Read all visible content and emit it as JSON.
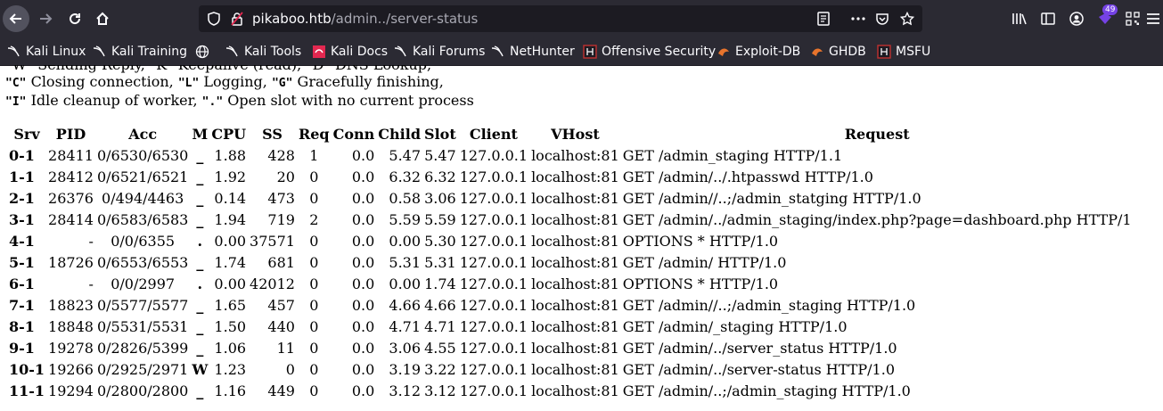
{
  "browser": {
    "url_host": "pikaboo.htb",
    "url_path": "/admin../server-status",
    "extensions_badge": "49"
  },
  "bookmarks": [
    {
      "label": "Kali Linux",
      "icon": "kali-dragon-icon"
    },
    {
      "label": "Kali Training",
      "icon": "kali-dragon-icon"
    },
    {
      "label": "",
      "icon": "globe-icon"
    },
    {
      "label": "Kali Tools",
      "icon": "kali-dragon-icon"
    },
    {
      "label": "Kali Docs",
      "icon": "kali-docs-icon"
    },
    {
      "label": "Kali Forums",
      "icon": "kali-dragon-icon"
    },
    {
      "label": "NetHunter",
      "icon": "kali-dragon-icon"
    },
    {
      "label": "Offensive Security",
      "icon": "offsec-icon"
    },
    {
      "label": "Exploit-DB",
      "icon": "exploitdb-icon"
    },
    {
      "label": "GHDB",
      "icon": "exploitdb-icon"
    },
    {
      "label": "MSFU",
      "icon": "offsec-icon"
    }
  ],
  "legend": {
    "line0": "\"W\" Sending Reply, \"K\" Keepalive (read), \"D\" DNS Lookup,",
    "line1_k1": "\"C\"",
    "line1_t1": " Closing connection, ",
    "line1_k2": "\"L\"",
    "line1_t2": " Logging, ",
    "line1_k3": "\"G\"",
    "line1_t3": " Gracefully finishing,",
    "line2_k1": "\"I\"",
    "line2_t1": " Idle cleanup of worker, ",
    "line2_k2": "\".\"",
    "line2_t2": " Open slot with no current process"
  },
  "table": {
    "headers": [
      "Srv",
      "PID",
      "Acc",
      "M",
      "CPU",
      "SS",
      "Req",
      "Conn",
      "Child",
      "Slot",
      "Client",
      "VHost",
      "Request"
    ],
    "rows": [
      [
        "0-1",
        "28411",
        "0/6530/6530",
        "_",
        "1.88",
        "428",
        "1",
        "0.0",
        "5.47",
        "5.47",
        "127.0.0.1",
        "localhost:81",
        "GET /admin_staging HTTP/1.1"
      ],
      [
        "1-1",
        "28412",
        "0/6521/6521",
        "_",
        "1.92",
        "20",
        "0",
        "0.0",
        "6.32",
        "6.32",
        "127.0.0.1",
        "localhost:81",
        "GET /admin/../.htpasswd HTTP/1.0"
      ],
      [
        "2-1",
        "26376",
        "0/494/4463",
        "_",
        "0.14",
        "473",
        "0",
        "0.0",
        "0.58",
        "3.06",
        "127.0.0.1",
        "localhost:81",
        "GET /admin//..;/admin_statging HTTP/1.0"
      ],
      [
        "3-1",
        "28414",
        "0/6583/6583",
        "_",
        "1.94",
        "719",
        "2",
        "0.0",
        "5.59",
        "5.59",
        "127.0.0.1",
        "localhost:81",
        "GET /admin/../admin_staging/index.php?page=dashboard.php HTTP/1"
      ],
      [
        "4-1",
        "-",
        "0/0/6355",
        ".",
        "0.00",
        "37571",
        "0",
        "0.0",
        "0.00",
        "5.30",
        "127.0.0.1",
        "localhost:81",
        "OPTIONS * HTTP/1.0"
      ],
      [
        "5-1",
        "18726",
        "0/6553/6553",
        "_",
        "1.74",
        "681",
        "0",
        "0.0",
        "5.31",
        "5.31",
        "127.0.0.1",
        "localhost:81",
        "GET /admin/ HTTP/1.0"
      ],
      [
        "6-1",
        "-",
        "0/0/2997",
        ".",
        "0.00",
        "42012",
        "0",
        "0.0",
        "0.00",
        "1.74",
        "127.0.0.1",
        "localhost:81",
        "OPTIONS * HTTP/1.0"
      ],
      [
        "7-1",
        "18823",
        "0/5577/5577",
        "_",
        "1.65",
        "457",
        "0",
        "0.0",
        "4.66",
        "4.66",
        "127.0.0.1",
        "localhost:81",
        "GET /admin//..;/admin_staging HTTP/1.0"
      ],
      [
        "8-1",
        "18848",
        "0/5531/5531",
        "_",
        "1.50",
        "440",
        "0",
        "0.0",
        "4.71",
        "4.71",
        "127.0.0.1",
        "localhost:81",
        "GET /admin/_staging HTTP/1.0"
      ],
      [
        "9-1",
        "19278",
        "0/2826/5399",
        "_",
        "1.06",
        "11",
        "0",
        "0.0",
        "3.06",
        "4.55",
        "127.0.0.1",
        "localhost:81",
        "GET /admin/../server_status HTTP/1.0"
      ],
      [
        "10-1",
        "19266",
        "0/2925/2971",
        "W",
        "1.23",
        "0",
        "0",
        "0.0",
        "3.19",
        "3.22",
        "127.0.0.1",
        "localhost:81",
        "GET /admin/../server-status HTTP/1.0"
      ],
      [
        "11-1",
        "19294",
        "0/2800/2800",
        "_",
        "1.16",
        "449",
        "0",
        "0.0",
        "3.12",
        "3.12",
        "127.0.0.1",
        "localhost:81",
        "GET /admin/..;/admin_staging HTTP/1.0"
      ]
    ]
  },
  "colors": {
    "chrome_bg": "#2b2a33",
    "urlbar_bg": "#1c1b22",
    "extension_accent": "#7542e5"
  }
}
